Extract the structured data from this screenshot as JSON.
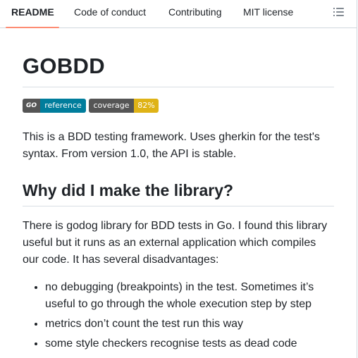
{
  "tabs": [
    {
      "label": "README",
      "active": true
    },
    {
      "label": "Code of conduct",
      "active": false
    },
    {
      "label": "Contributing",
      "active": false
    },
    {
      "label": "MIT license",
      "active": false
    }
  ],
  "toc_icon": "list-unordered-icon",
  "readme": {
    "title": "GOBDD",
    "badges": {
      "go_reference": {
        "left": "GO",
        "right": "reference",
        "color": "#007d9c"
      },
      "coverage": {
        "left": "coverage",
        "right": "82%",
        "color": "#dfb317"
      }
    },
    "intro": "This is a BDD testing framework. Uses gherkin for the test's syntax. From version 1.0, the API is stable.",
    "section_heading": "Why did I make the library?",
    "section_text": "There is godog library for BDD tests in Go. I found this library useful but it runs as an external application which compiles our code. It has several disadvantages:",
    "disadvantages": [
      "no debugging (breakpoints) in the test. Sometimes it’s useful to go through the whole execution step by step",
      "metrics don’t count the test run this way",
      "some style checkers recognise tests as dead code"
    ]
  },
  "colors": {
    "active_tab_underline": "#fd8c73",
    "border": "#d0d7de"
  }
}
